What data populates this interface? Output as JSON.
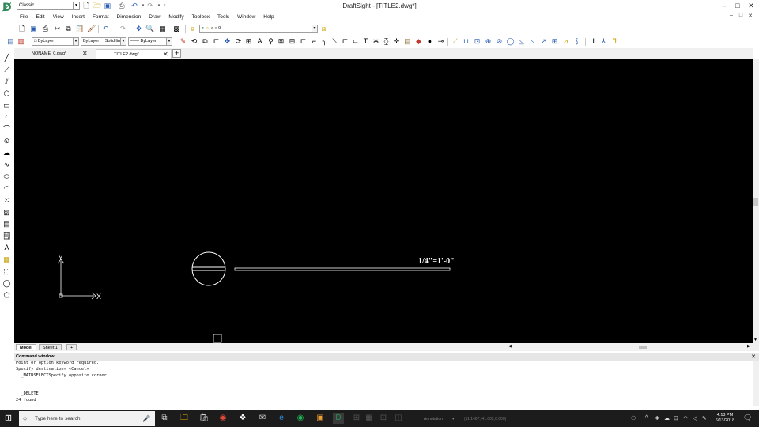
{
  "app": {
    "window_title": "DraftSight - [TITLE2.dwg*]",
    "workspace": "Classic",
    "window_controls": [
      "–",
      "□",
      "✕"
    ]
  },
  "menu": [
    "File",
    "Edit",
    "View",
    "Insert",
    "Format",
    "Dimension",
    "Draw",
    "Modify",
    "Toolbox",
    "Tools",
    "Window",
    "Help"
  ],
  "layer_combo": "0",
  "properties": {
    "color": "ByLayer",
    "linestyle": "ByLayer",
    "line_display": "Solid line",
    "lineweight": "ByLayer"
  },
  "doc_tabs": [
    {
      "label": "NONAME_0.dwg*",
      "active": false
    },
    {
      "label": "TITLE2.dwg*",
      "active": true
    }
  ],
  "new_tab_label": "+",
  "canvas": {
    "scale_text": "1/4\"=1'-0\"",
    "ucs_x": "X",
    "ucs_y": "Y"
  },
  "layout_tabs": [
    {
      "label": "Model",
      "active": true
    },
    {
      "label": "Sheet 1",
      "active": false
    }
  ],
  "layout_add": "+",
  "command_window": {
    "title": "Command window",
    "lines": [
      "Point or option keyword required.",
      "Specify destination» «Cancel»",
      ": _MAINSELECTSpecify opposite corner:",
      ":",
      ":",
      ": _DELETE",
      "24 found"
    ]
  },
  "taskbar": {
    "search_placeholder": "Type here to search",
    "workspace_status": "Annotation",
    "coords": "(11.1407,-41.002,0.000)",
    "time": "4:13 PM",
    "date": "6/13/2018"
  }
}
